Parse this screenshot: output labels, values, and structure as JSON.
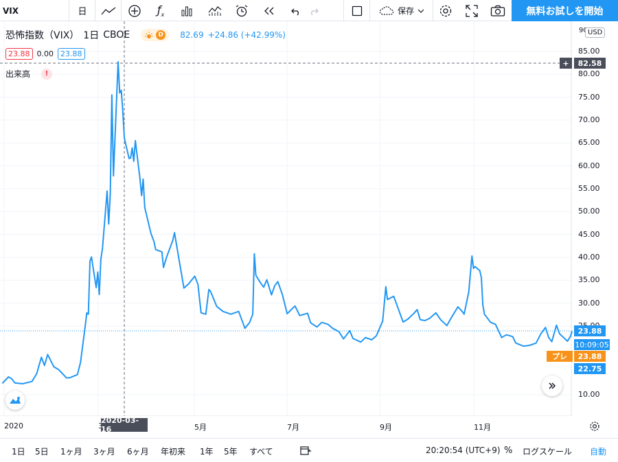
{
  "toolbar": {
    "symbol": "VIX",
    "interval": "日",
    "save_label": "保存",
    "cta_label": "無料お試しを開始"
  },
  "legend": {
    "title": "恐怖指数（VIX）",
    "interval": "1日",
    "exchange": "CBOE",
    "market_badge": "D",
    "last_value": "82.69",
    "change": "+24.86 (+42.99%)",
    "bid": "23.88",
    "spread": "0.00",
    "ask": "23.88",
    "volume_label": "出来高",
    "volume_alert": "!"
  },
  "price_scale": {
    "currency": "USD",
    "ticks": [
      "85.00",
      "80.00",
      "75.00",
      "70.00",
      "65.00",
      "60.00",
      "55.00",
      "50.00",
      "45.00",
      "40.00",
      "35.00",
      "30.00",
      "25.00",
      "10.00"
    ],
    "crosshair_value": "82.58",
    "last_price": "23.88",
    "countdown": "10:09:05",
    "premarket_label": "プレ",
    "premarket_price": "23.88",
    "low_price": "22.75"
  },
  "time_axis": {
    "ticks": [
      "2020",
      "3",
      "5月",
      "7月",
      "9月",
      "11月"
    ],
    "crosshair_date": "2020-03-16"
  },
  "bottom_bar": {
    "ranges": [
      "1日",
      "5日",
      "1ヶ月",
      "3ヶ月",
      "6ヶ月",
      "年初来",
      "1年",
      "5年",
      "すべて"
    ],
    "clock": "20:20:54 (UTC+9)",
    "percent_label": "%",
    "log_label": "ログスケール",
    "auto_label": "自動"
  },
  "colors": {
    "line": "#2196f3",
    "crosshair_label_bg": "#4a4e5a",
    "premarket": "#f7931a",
    "accent": "#2196f3"
  },
  "chart_data": {
    "type": "line",
    "ylim": [
      5,
      90
    ],
    "points": [
      [
        "2020-01-02",
        12.5
      ],
      [
        "2020-01-06",
        13.9
      ],
      [
        "2020-01-08",
        13.5
      ],
      [
        "2020-01-10",
        12.6
      ],
      [
        "2020-01-15",
        12.4
      ],
      [
        "2020-01-21",
        12.9
      ],
      [
        "2020-01-24",
        14.6
      ],
      [
        "2020-01-27",
        18.2
      ],
      [
        "2020-01-29",
        16.4
      ],
      [
        "2020-01-31",
        18.8
      ],
      [
        "2020-02-04",
        16.1
      ],
      [
        "2020-02-07",
        15.5
      ],
      [
        "2020-02-12",
        13.7
      ],
      [
        "2020-02-14",
        13.7
      ],
      [
        "2020-02-19",
        14.4
      ],
      [
        "2020-02-21",
        17.1
      ],
      [
        "2020-02-24",
        25.0
      ],
      [
        "2020-02-25",
        27.9
      ],
      [
        "2020-02-26",
        27.6
      ],
      [
        "2020-02-27",
        39.2
      ],
      [
        "2020-02-28",
        40.1
      ],
      [
        "2020-03-02",
        33.4
      ],
      [
        "2020-03-03",
        36.8
      ],
      [
        "2020-03-04",
        31.9
      ],
      [
        "2020-03-05",
        39.6
      ],
      [
        "2020-03-06",
        41.9
      ],
      [
        "2020-03-09",
        54.5
      ],
      [
        "2020-03-10",
        47.3
      ],
      [
        "2020-03-11",
        53.9
      ],
      [
        "2020-03-12",
        75.5
      ],
      [
        "2020-03-13",
        57.8
      ],
      [
        "2020-03-16",
        82.7
      ],
      [
        "2020-03-17",
        75.9
      ],
      [
        "2020-03-18",
        76.5
      ],
      [
        "2020-03-19",
        72.0
      ],
      [
        "2020-03-20",
        66.0
      ],
      [
        "2020-03-23",
        61.6
      ],
      [
        "2020-03-24",
        61.7
      ],
      [
        "2020-03-25",
        63.9
      ],
      [
        "2020-03-26",
        61.0
      ],
      [
        "2020-03-27",
        65.5
      ],
      [
        "2020-03-30",
        57.1
      ],
      [
        "2020-03-31",
        53.5
      ],
      [
        "2020-04-01",
        57.1
      ],
      [
        "2020-04-02",
        50.9
      ],
      [
        "2020-04-06",
        45.2
      ],
      [
        "2020-04-08",
        43.4
      ],
      [
        "2020-04-09",
        41.7
      ],
      [
        "2020-04-13",
        41.2
      ],
      [
        "2020-04-14",
        37.8
      ],
      [
        "2020-04-16",
        40.1
      ],
      [
        "2020-04-20",
        43.8
      ],
      [
        "2020-04-21",
        45.4
      ],
      [
        "2020-04-23",
        41.4
      ],
      [
        "2020-04-27",
        33.3
      ],
      [
        "2020-04-30",
        34.2
      ],
      [
        "2020-05-04",
        35.9
      ],
      [
        "2020-05-06",
        34.1
      ],
      [
        "2020-05-08",
        27.9
      ],
      [
        "2020-05-11",
        27.6
      ],
      [
        "2020-05-13",
        33.0
      ],
      [
        "2020-05-14",
        32.6
      ],
      [
        "2020-05-18",
        29.3
      ],
      [
        "2020-05-22",
        28.2
      ],
      [
        "2020-05-27",
        27.6
      ],
      [
        "2020-06-01",
        28.2
      ],
      [
        "2020-06-05",
        24.5
      ],
      [
        "2020-06-08",
        25.8
      ],
      [
        "2020-06-10",
        27.6
      ],
      [
        "2020-06-11",
        40.8
      ],
      [
        "2020-06-12",
        36.1
      ],
      [
        "2020-06-15",
        34.4
      ],
      [
        "2020-06-17",
        33.5
      ],
      [
        "2020-06-19",
        35.1
      ],
      [
        "2020-06-22",
        31.8
      ],
      [
        "2020-06-24",
        33.8
      ],
      [
        "2020-06-26",
        34.7
      ],
      [
        "2020-06-29",
        31.8
      ],
      [
        "2020-07-02",
        27.7
      ],
      [
        "2020-07-07",
        29.4
      ],
      [
        "2020-07-10",
        27.3
      ],
      [
        "2020-07-15",
        27.8
      ],
      [
        "2020-07-17",
        25.7
      ],
      [
        "2020-07-21",
        24.8
      ],
      [
        "2020-07-24",
        25.8
      ],
      [
        "2020-07-28",
        25.4
      ],
      [
        "2020-07-31",
        24.5
      ],
      [
        "2020-08-04",
        23.8
      ],
      [
        "2020-08-07",
        22.2
      ],
      [
        "2020-08-11",
        24.0
      ],
      [
        "2020-08-13",
        22.3
      ],
      [
        "2020-08-18",
        21.5
      ],
      [
        "2020-08-21",
        22.5
      ],
      [
        "2020-08-25",
        22.0
      ],
      [
        "2020-08-28",
        22.9
      ],
      [
        "2020-09-01",
        26.1
      ],
      [
        "2020-09-03",
        33.6
      ],
      [
        "2020-09-04",
        30.8
      ],
      [
        "2020-09-08",
        31.5
      ],
      [
        "2020-09-10",
        29.7
      ],
      [
        "2020-09-14",
        25.9
      ],
      [
        "2020-09-17",
        26.5
      ],
      [
        "2020-09-21",
        27.8
      ],
      [
        "2020-09-23",
        28.6
      ],
      [
        "2020-09-25",
        26.4
      ],
      [
        "2020-09-28",
        26.2
      ],
      [
        "2020-10-01",
        26.7
      ],
      [
        "2020-10-05",
        27.9
      ],
      [
        "2020-10-08",
        26.4
      ],
      [
        "2020-10-12",
        25.1
      ],
      [
        "2020-10-15",
        26.9
      ],
      [
        "2020-10-19",
        29.2
      ],
      [
        "2020-10-22",
        28.1
      ],
      [
        "2020-10-23",
        27.6
      ],
      [
        "2020-10-26",
        32.5
      ],
      [
        "2020-10-28",
        40.3
      ],
      [
        "2020-10-29",
        37.6
      ],
      [
        "2020-10-30",
        38.0
      ],
      [
        "2020-11-02",
        37.1
      ],
      [
        "2020-11-03",
        35.6
      ],
      [
        "2020-11-04",
        29.6
      ],
      [
        "2020-11-05",
        27.6
      ],
      [
        "2020-11-09",
        25.8
      ],
      [
        "2020-11-12",
        25.4
      ],
      [
        "2020-11-16",
        22.5
      ],
      [
        "2020-11-19",
        23.1
      ],
      [
        "2020-11-23",
        22.7
      ],
      [
        "2020-11-25",
        21.3
      ],
      [
        "2020-11-30",
        20.6
      ],
      [
        "2020-12-04",
        20.8
      ],
      [
        "2020-12-08",
        21.3
      ],
      [
        "2020-12-11",
        23.3
      ],
      [
        "2020-12-14",
        24.7
      ],
      [
        "2020-12-16",
        22.5
      ],
      [
        "2020-12-18",
        21.6
      ],
      [
        "2020-12-21",
        25.2
      ],
      [
        "2020-12-23",
        23.3
      ],
      [
        "2020-12-28",
        21.7
      ],
      [
        "2020-12-30",
        22.8
      ],
      [
        "2020-12-31",
        23.9
      ]
    ]
  }
}
